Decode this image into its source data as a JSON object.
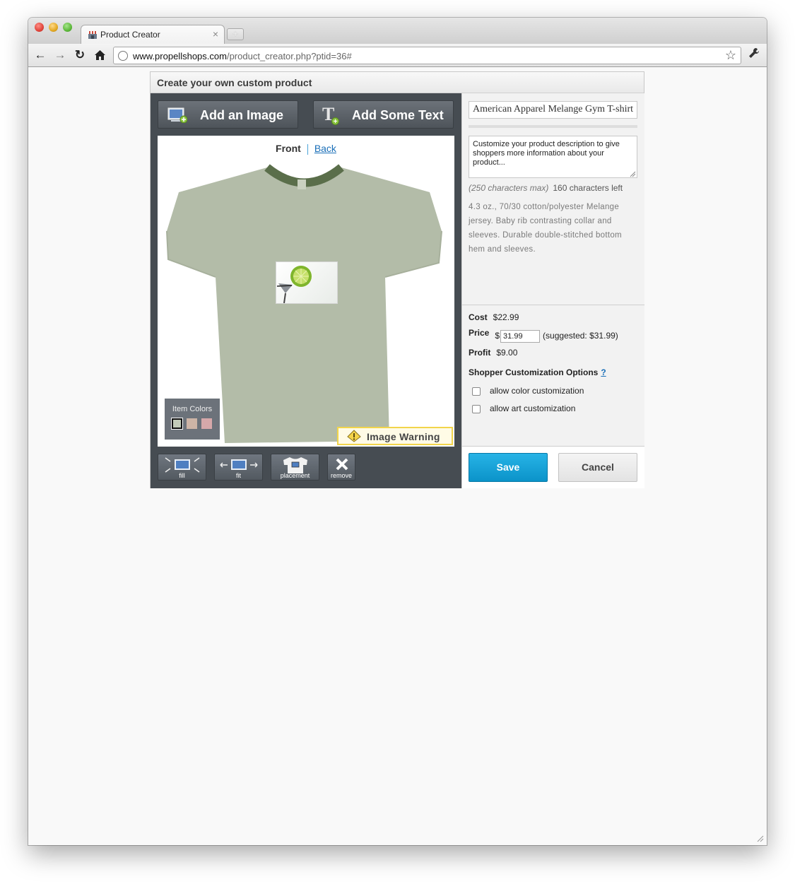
{
  "browser": {
    "tab_title": "Product Creator",
    "new_tab_label": "+",
    "close_tab_label": "×",
    "url_host": "www.propellshops.com",
    "url_path": "/product_creator.php?ptid=36#"
  },
  "panel": {
    "title": "Create your own custom product"
  },
  "designer": {
    "add_image_label": "Add an Image",
    "add_text_label": "Add Some Text",
    "front_label": "Front",
    "back_label": "Back",
    "item_colors_label": "Item Colors",
    "swatch_colors": [
      "#c3cbb9",
      "#cdb4a6",
      "#d6a8aa"
    ],
    "shirt_color": "#b3bca8",
    "collar_color": "#5a6e4a",
    "image_warning_label": "Image Warning",
    "tools": {
      "fill": "fill",
      "fit": "fit",
      "placement": "placement",
      "remove": "remove"
    }
  },
  "details": {
    "product_title": "American Apparel Melange Gym T-shirt",
    "description_placeholder": "Customize your product description to give shoppers more information about your product...",
    "max_chars_note": "(250 characters max)",
    "chars_left": "160 characters left",
    "product_description": "4.3 oz., 70/30 cotton/polyester Melange jersey. Baby rib contrasting collar and sleeves. Durable double-stitched bottom hem and sleeves."
  },
  "pricing": {
    "cost_label": "Cost",
    "cost_value": "$22.99",
    "price_label": "Price",
    "currency_symbol": "$",
    "price_value": "31.99",
    "suggested": "(suggested: $31.99)",
    "profit_label": "Profit",
    "profit_value": "$9.00",
    "options_heading": "Shopper Customization Options",
    "help_label": "?",
    "allow_color": "allow color customization",
    "allow_art": "allow art customization"
  },
  "actions": {
    "save_label": "Save",
    "cancel_label": "Cancel"
  },
  "colors": {
    "save_blue": "#0b9fd8",
    "designer_dark": "#464c52",
    "warning_yellow": "#f2d54b",
    "link_blue": "#1a6fb8"
  }
}
